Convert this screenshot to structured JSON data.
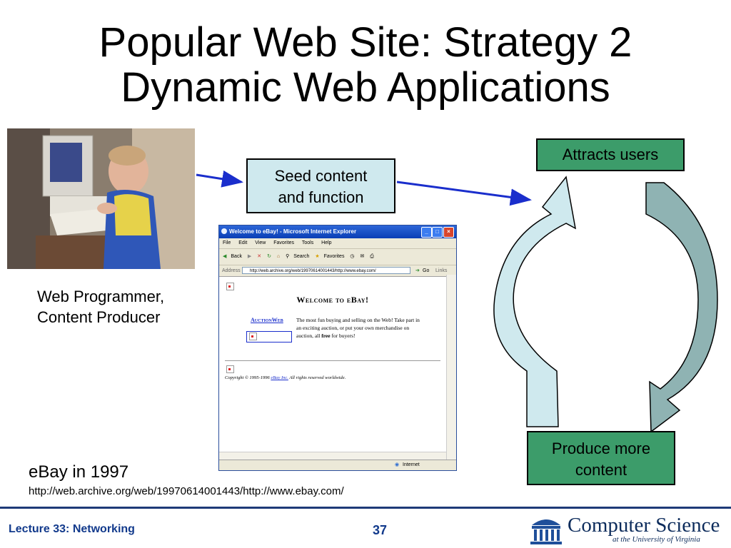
{
  "title": {
    "line1": "Popular Web Site: Strategy 2",
    "line2": "Dynamic Web Applications"
  },
  "caption": {
    "line1": "Web Programmer,",
    "line2": "Content Producer"
  },
  "boxes": {
    "seed_line1": "Seed content",
    "seed_line2": "and function",
    "attracts": "Attracts users",
    "produce_line1": "Produce more",
    "produce_line2": "content"
  },
  "browser": {
    "window_title": "Welcome to eBay! - Microsoft Internet Explorer",
    "menu": [
      "File",
      "Edit",
      "View",
      "Favorites",
      "Tools",
      "Help"
    ],
    "toolbar": [
      "Back",
      "Search",
      "Favorites"
    ],
    "address_label": "Address",
    "address_value": "http://web.archive.org/web/19970614001443/http://www.ebay.com/",
    "go_label": "Go",
    "links_label": "Links",
    "heading": "Welcome to eBay!",
    "auctionweb_link": "AuctionWeb",
    "body_text_1": "The most fun buying and selling on the Web! Take part in an exciting auction, or put your own merchandise on auction, all ",
    "body_bold": "free",
    "body_text_2": " for buyers!",
    "copyright_prefix": "Copyright © 1995-1996 ",
    "copyright_link": "eBay Inc.",
    "copyright_suffix": " All rights reserved worldwide.",
    "status": "Internet"
  },
  "ebay": {
    "label": "eBay in 1997",
    "url": "http://web.archive.org/web/19970614001443/http://www.ebay.com/"
  },
  "footer": {
    "lecture": "Lecture 33: Networking",
    "page": "37",
    "logo_name": "Computer Science",
    "logo_sub": "at the University of Virginia"
  },
  "colors": {
    "seed_fill": "#cfe9ee",
    "green_fill": "#3c9c6a",
    "arrow_light": "#cfe9ee",
    "arrow_dark": "#8fb3b3",
    "connector": "#1a2ecc",
    "footer_blue": "#123a8c"
  }
}
